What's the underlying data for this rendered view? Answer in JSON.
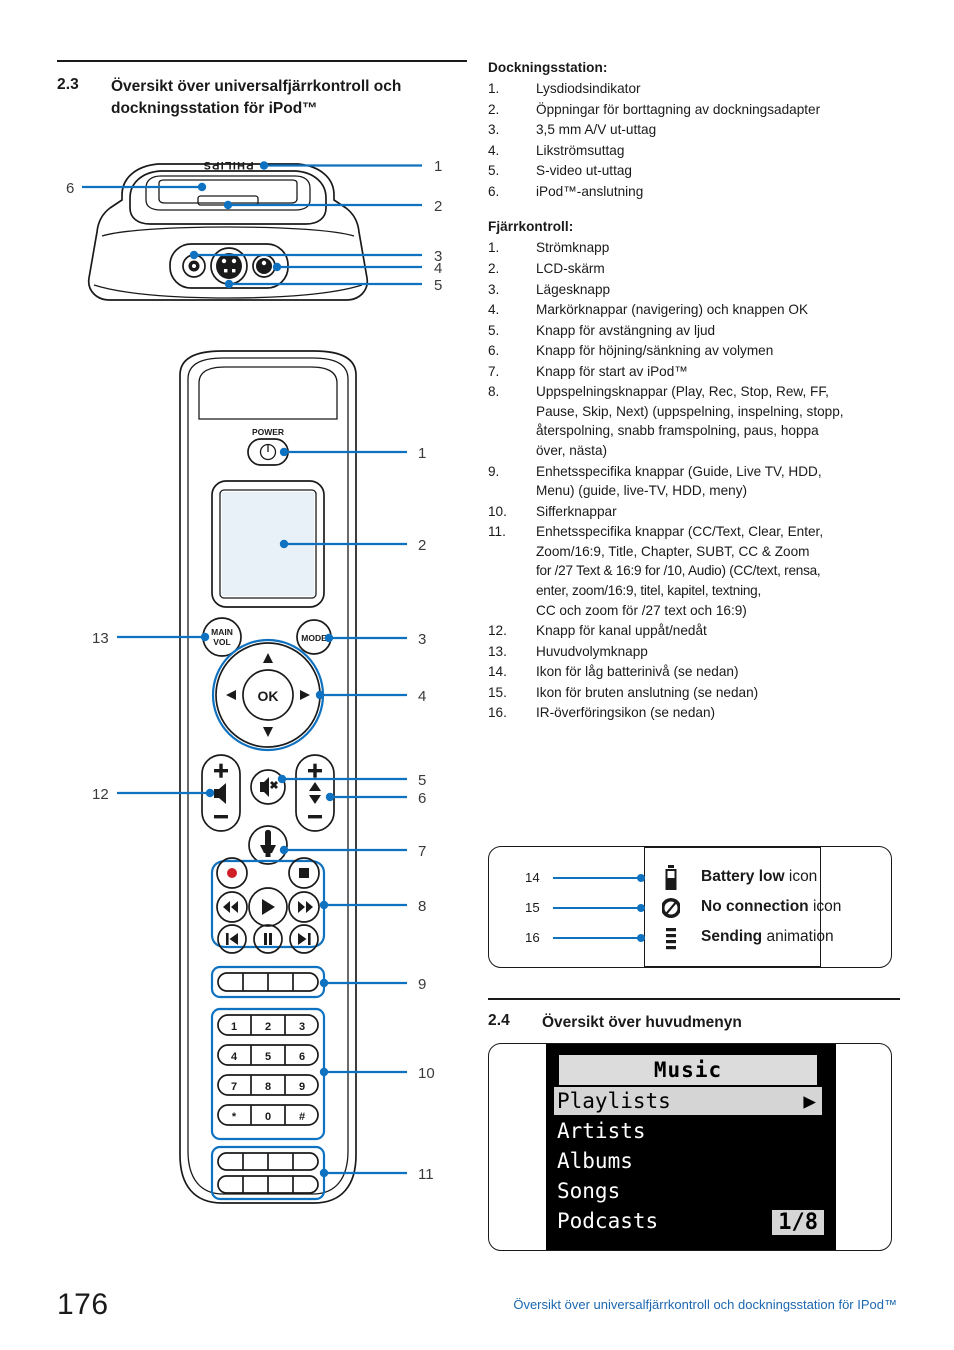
{
  "page": {
    "number": "176",
    "footer_text": "Översikt över universalfjärrkontroll och dockningsstation för IPod™",
    "footer_color": "#1b67b2",
    "accent_color": "#0f72c0"
  },
  "section_23": {
    "number": "2.3",
    "title_line1": "Översikt över universalfjärrkontroll och",
    "title_line2": "dockningsstation för iPod™"
  },
  "section_24": {
    "number": "2.4",
    "title": "Översikt över huvudmenyn"
  },
  "dock": {
    "heading": "Dockningsstation:",
    "items": [
      {
        "n": "1.",
        "t": "Lysdiodsindikator"
      },
      {
        "n": "2.",
        "t": "Öppningar för borttagning av dockningsadapter"
      },
      {
        "n": "3.",
        "t": "3,5 mm A/V ut-uttag"
      },
      {
        "n": "4.",
        "t": "Likströmsuttag"
      },
      {
        "n": "5.",
        "t": "S-video ut-uttag"
      },
      {
        "n": "6.",
        "t": "iPod™-anslutning"
      }
    ],
    "brand": "PHILIPS",
    "callouts": [
      "1",
      "2",
      "3",
      "4",
      "5",
      "6"
    ]
  },
  "remote": {
    "heading": "Fjärrkontroll:",
    "items": [
      {
        "n": "1.",
        "lines": [
          "Strömknapp"
        ]
      },
      {
        "n": "2.",
        "lines": [
          "LCD-skärm"
        ]
      },
      {
        "n": "3.",
        "lines": [
          "Lägesknapp"
        ]
      },
      {
        "n": "4.",
        "lines": [
          "Markörknappar (navigering) och knappen OK"
        ]
      },
      {
        "n": "5.",
        "lines": [
          "Knapp för avstängning av ljud"
        ]
      },
      {
        "n": "6.",
        "lines": [
          "Knapp för höjning/sänkning av volymen"
        ]
      },
      {
        "n": "7.",
        "lines": [
          "Knapp för start av iPod™"
        ]
      },
      {
        "n": "8.",
        "lines": [
          "Uppspelningsknappar (Play, Rec, Stop, Rew, FF,",
          "Pause, Skip, Next) (uppspelning, inspelning, stopp,",
          "återspolning, snabb framspolning, paus, hoppa",
          "över, nästa)"
        ]
      },
      {
        "n": "9.",
        "lines": [
          "Enhetsspecifika knappar (Guide, Live TV, HDD,",
          "Menu) (guide, live-TV, HDD, meny)"
        ]
      },
      {
        "n": "10.",
        "lines": [
          "Sifferknappar"
        ]
      },
      {
        "n": "11.",
        "lines": [
          "Enhetsspecifika knappar (CC/Text, Clear, Enter,",
          "Zoom/16:9, Title, Chapter, SUBT, CC & Zoom",
          "for /27 Text & 16:9 for /10, Audio) (CC/text, rensa,",
          "enter, zoom/16:9, titel, kapitel, textning,",
          "CC och zoom för /27 text och 16:9)"
        ]
      },
      {
        "n": "12.",
        "lines": [
          "Knapp för kanal uppåt/nedåt"
        ]
      },
      {
        "n": "13.",
        "lines": [
          "Huvudvolymknapp"
        ]
      },
      {
        "n": "14.",
        "lines": [
          "Ikon för låg batterinivå (se nedan)"
        ]
      },
      {
        "n": "15.",
        "lines": [
          "Ikon för bruten anslutning (se nedan)"
        ]
      },
      {
        "n": "16.",
        "lines": [
          "IR-överföringsikon (se nedan)"
        ]
      }
    ],
    "button_labels": {
      "power": "POWER",
      "main_vol": "MAIN",
      "main_vol2": "VOL",
      "mode": "MODE",
      "ok": "OK"
    },
    "keypad": [
      [
        "1",
        "2",
        "3"
      ],
      [
        "4",
        "5",
        "6"
      ],
      [
        "7",
        "8",
        "9"
      ],
      [
        "*",
        "0",
        "#"
      ]
    ],
    "callouts": [
      "1",
      "2",
      "3",
      "4",
      "5",
      "6",
      "7",
      "8",
      "9",
      "10",
      "11",
      "12",
      "13"
    ]
  },
  "legend": {
    "rows": [
      {
        "num": "14",
        "icon": "battery-low-icon",
        "bold": "Battery low",
        "rest": " icon"
      },
      {
        "num": "15",
        "icon": "no-connection-icon",
        "bold": "No connection",
        "rest": " icon"
      },
      {
        "num": "16",
        "icon": "sending-icon",
        "bold": "Sending",
        "rest": " animation"
      }
    ]
  },
  "lcd": {
    "title": "Music",
    "selected": "Playlists",
    "items": [
      "Artists",
      "Albums",
      "Songs",
      "Podcasts"
    ],
    "page_indicator": "1/8",
    "arrow": "▶"
  }
}
